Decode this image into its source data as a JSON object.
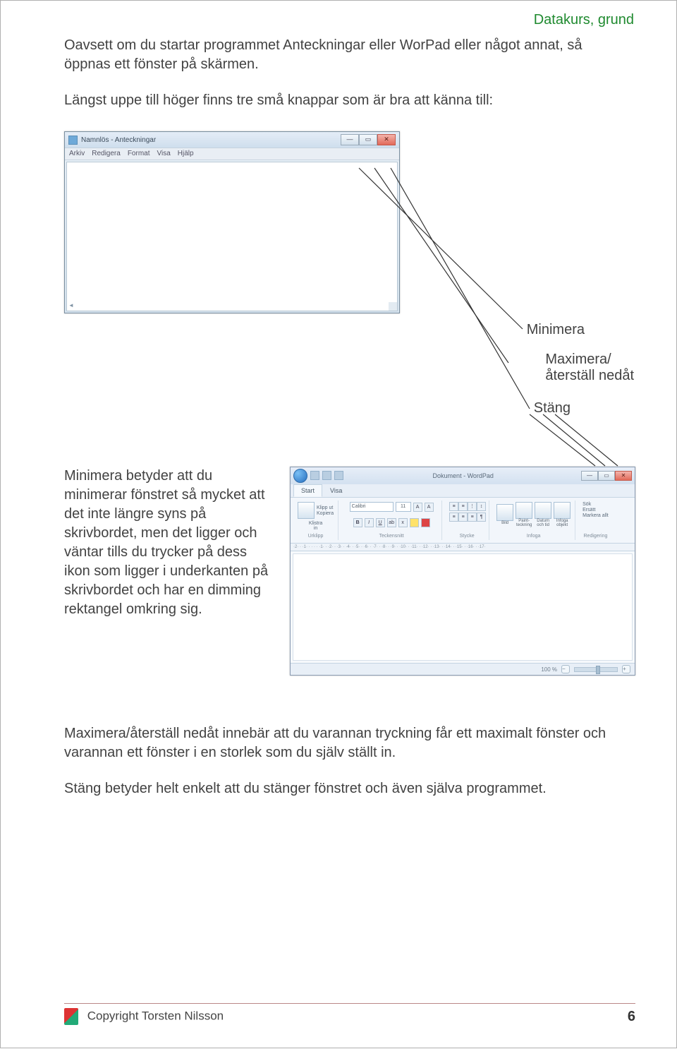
{
  "header": "Datakurs, grund",
  "p1": "Oavsett om du startar programmet Anteckningar eller WorPad eller något annat, så öppnas ett fönster på skärmen.",
  "p2": "Längst uppe till höger finns tre små knappar som är bra att känna till:",
  "notepad": {
    "title": "Namnlös - Anteckningar",
    "menus": [
      "Arkiv",
      "Redigera",
      "Format",
      "Visa",
      "Hjälp"
    ]
  },
  "labels": {
    "minimera": "Minimera",
    "maximera": "Maximera/\nåterställ nedåt",
    "stang": "Stäng"
  },
  "p3": "Minimera betyder att du minimerar fönstret så mycket att det inte längre syns på skrivbordet, men det ligger och väntar tills du trycker på dess ikon som ligger i underkanten på skrivbordet och har en dimming rektangel omkring sig.",
  "wordpad": {
    "title": "Dokument - WordPad",
    "tabs": [
      "Start",
      "Visa"
    ],
    "clipboard": {
      "paste": "Klistra\nin",
      "cut": "Klipp ut",
      "copy": "Kopiera",
      "label": "Urklipp"
    },
    "font": {
      "name": "Calibri",
      "size": "11",
      "label": "Teckensnitt"
    },
    "para": {
      "label": "Stycke"
    },
    "insert": {
      "items": [
        "Bild",
        "Paint-\nteckning",
        "Datum\noch tid",
        "Infoga\nobjekt"
      ],
      "label": "Infoga"
    },
    "edit": {
      "find": "Sök",
      "replace": "Ersätt",
      "select": "Markera allt",
      "label": "Redigering"
    },
    "ruler": "·2· · ·1· · · · · ·1· · ·2· · ·3· · ·4· · ·5· · ·6· · ·7· · ·8· · ·9· · ·10· · ·11· · ·12· · ·13· · ·14· · ·15· · ·16· · ·17·",
    "zoom": "100 %"
  },
  "p4": "Maximera/återställ nedåt innebär att du varannan tryckning får ett maximalt fönster och varannan ett fönster i en storlek som du själv ställt in.",
  "p5": "Stäng betyder helt enkelt att du stänger fönstret och även själva programmet.",
  "footer": {
    "copyright": "Copyright Torsten Nilsson",
    "page": "6"
  }
}
